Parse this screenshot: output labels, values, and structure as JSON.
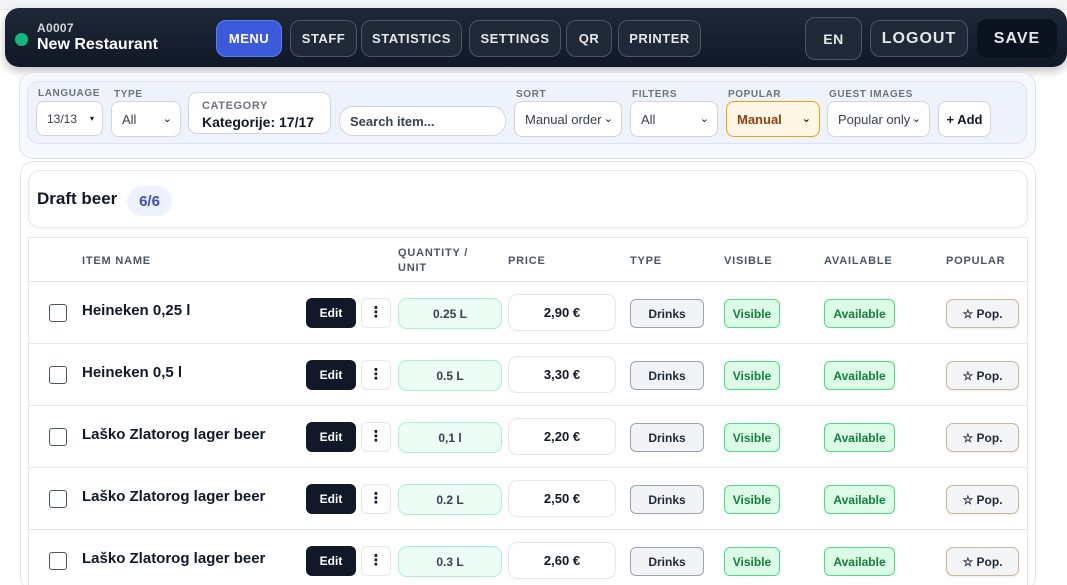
{
  "header": {
    "restaurant_code": "A0007",
    "restaurant_name": "New Restaurant",
    "nav": {
      "menu": "MENU",
      "staff": "STAFF",
      "statistics": "STATISTICS",
      "settings": "SETTINGS",
      "qr": "QR",
      "printer": "PRINTER"
    },
    "language_btn": "EN",
    "logout": "LOGOUT",
    "save": "SAVE"
  },
  "toolbar": {
    "language": {
      "label": "LANGUAGE",
      "value": "13/13"
    },
    "type": {
      "label": "TYPE",
      "value": "All"
    },
    "category": {
      "label": "CATEGORY",
      "value": "Kategorije: 17/17"
    },
    "search": {
      "placeholder": "Search item..."
    },
    "sort": {
      "label": "SORT",
      "value": "Manual order"
    },
    "filters": {
      "label": "FILTERS",
      "value": "All"
    },
    "popular": {
      "label": "POPULAR",
      "value": "Manual"
    },
    "guest_images": {
      "label": "GUEST IMAGES",
      "value": "Popular only"
    },
    "add": "+ Add"
  },
  "category": {
    "title": "Draft beer",
    "count": "6/6"
  },
  "table": {
    "headers": {
      "item_name": "ITEM NAME",
      "quantity_line1": "QUANTITY /",
      "quantity_line2": "UNIT",
      "price": "PRICE",
      "type": "TYPE",
      "visible": "VISIBLE",
      "available": "AVAILABLE",
      "popular": "POPULAR"
    },
    "edit_label": "Edit",
    "more_label": "⋮",
    "rows": [
      {
        "name": "Heineken 0,25 l",
        "qty": "0.25 L",
        "price": "2,90 €",
        "type": "Drinks",
        "visible": "Visible",
        "available": "Available",
        "popular": "☆ Pop."
      },
      {
        "name": "Heineken 0,5 l",
        "qty": "0.5 L",
        "price": "3,30 €",
        "type": "Drinks",
        "visible": "Visible",
        "available": "Available",
        "popular": "☆ Pop."
      },
      {
        "name": "Laško Zlatorog lager beer",
        "qty": "0,1 l",
        "price": "2,20 €",
        "type": "Drinks",
        "visible": "Visible",
        "available": "Available",
        "popular": "☆ Pop."
      },
      {
        "name": "Laško Zlatorog lager beer",
        "qty": "0.2 L",
        "price": "2,50 €",
        "type": "Drinks",
        "visible": "Visible",
        "available": "Available",
        "popular": "☆ Pop."
      },
      {
        "name": "Laško Zlatorog lager beer",
        "qty": "0.3 L",
        "price": "2,60 €",
        "type": "Drinks",
        "visible": "Visible",
        "available": "Available",
        "popular": "☆ Pop."
      }
    ]
  },
  "colors": {
    "nav_active": "#3b5bdb",
    "status_online": "#10b981",
    "visible_green": "#15803d",
    "popular_accent": "#f59e0b"
  }
}
